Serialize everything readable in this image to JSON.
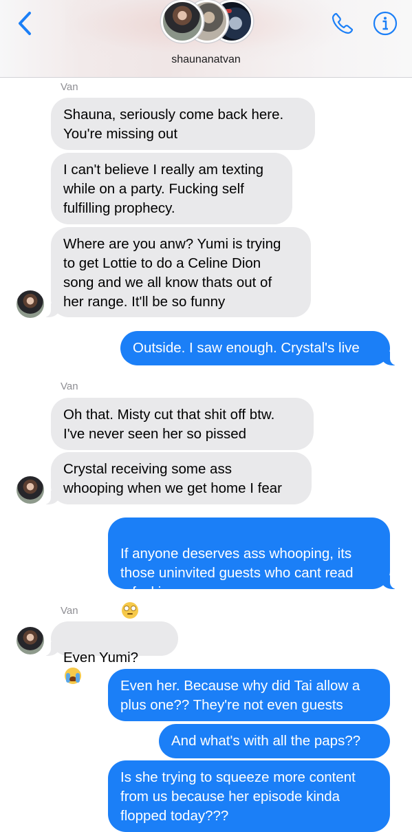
{
  "header": {
    "title": "shaunanatvan",
    "colors": {
      "accent": "#1b7ff7"
    },
    "icons": {
      "back": "chevron-left-icon",
      "call": "phone-icon",
      "info": "info-icon"
    }
  },
  "messages": [
    {
      "sender": "Van",
      "text": "Shauna, seriously come back here.\nYou're missing out"
    },
    {
      "text": "I can't believe I really am texting\nwhile on a party. Fucking self\nfulfilling prophecy."
    },
    {
      "text": "Where are you anw? Yumi is trying\nto get Lottie to do a Celine Dion\nsong and we all know thats out of\nher range. It'll be so funny"
    },
    {
      "text": "Outside. I saw enough. Crystal's live"
    },
    {
      "sender": "Van",
      "text": "Oh that. Misty cut that shit off btw.\nI've never seen her so pissed"
    },
    {
      "text": "Crystal receiving some ass\nwhooping when we get home I fear"
    },
    {
      "text": "If anyone deserves ass whooping, its\nthose uninvited guests who cant read\na fucking room"
    },
    {
      "sender": "Van",
      "text": "Even Yumi?"
    },
    {
      "text": "Even her. Because why did Tai allow a\nplus one?? They're not even guests"
    },
    {
      "text": "And what's with all the paps??"
    },
    {
      "text": "Is she trying to squeeze more content\nfrom us because her episode kinda\nflopped today???"
    }
  ],
  "emoji": {
    "rolling_eyes": "face-with-rolling-eyes-emoji",
    "crying": "loudly-crying-face-emoji"
  }
}
